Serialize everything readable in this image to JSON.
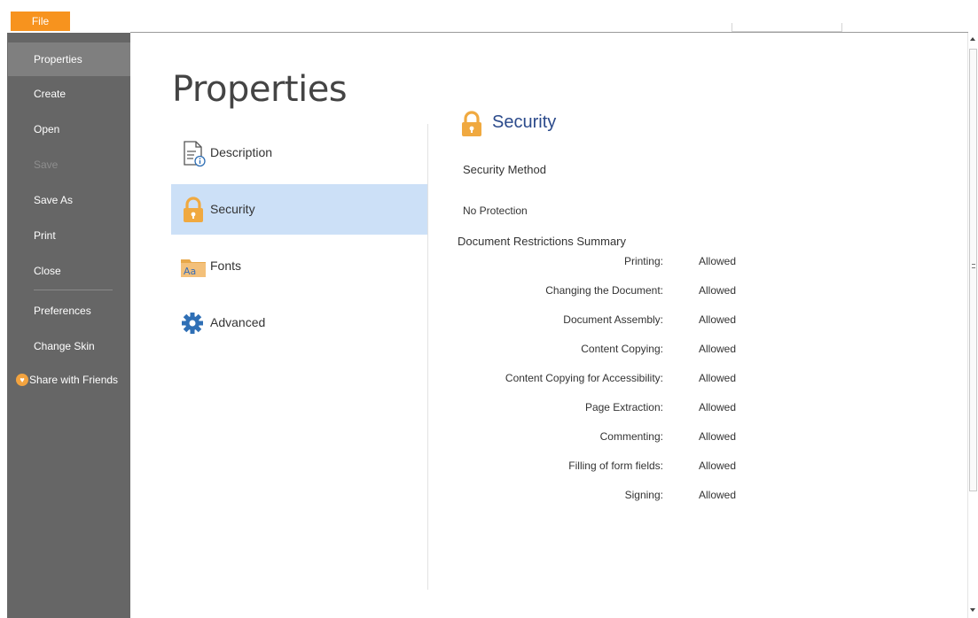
{
  "file_tab": {
    "label": "File"
  },
  "sidebar": {
    "items": [
      {
        "label": "Properties",
        "state": "active"
      },
      {
        "label": "Create",
        "state": "normal"
      },
      {
        "label": "Open",
        "state": "normal"
      },
      {
        "label": "Save",
        "state": "disabled"
      },
      {
        "label": "Save As",
        "state": "normal"
      },
      {
        "label": "Print",
        "state": "normal"
      },
      {
        "label": "Close",
        "state": "normal"
      },
      {
        "label": "Preferences",
        "state": "normal"
      },
      {
        "label": "Change Skin",
        "state": "normal"
      },
      {
        "label": "Share with Friends",
        "state": "normal",
        "icon": "heart-icon"
      }
    ]
  },
  "main": {
    "title": "Properties",
    "categories": [
      {
        "label": "Description",
        "icon": "document-info-icon"
      },
      {
        "label": "Security",
        "icon": "lock-icon",
        "selected": true
      },
      {
        "label": "Fonts",
        "icon": "fonts-icon"
      },
      {
        "label": "Advanced",
        "icon": "gear-icon"
      }
    ]
  },
  "security": {
    "heading": "Security",
    "method_label": "Security Method",
    "method_value": "No Protection",
    "restrictions_title": "Document Restrictions Summary",
    "restrictions": [
      {
        "name": "Printing:",
        "value": "Allowed"
      },
      {
        "name": "Changing the Document:",
        "value": "Allowed"
      },
      {
        "name": "Document Assembly:",
        "value": "Allowed"
      },
      {
        "name": "Content Copying:",
        "value": "Allowed"
      },
      {
        "name": "Content Copying for Accessibility:",
        "value": "Allowed"
      },
      {
        "name": "Page Extraction:",
        "value": "Allowed"
      },
      {
        "name": "Commenting:",
        "value": "Allowed"
      },
      {
        "name": "Filling of form fields:",
        "value": "Allowed"
      },
      {
        "name": "Signing:",
        "value": "Allowed"
      }
    ]
  },
  "colors": {
    "file_tab": "#f7931e",
    "sidebar_bg": "#666666",
    "sidebar_active": "#7f7f7f",
    "selected_category": "#cce0f7",
    "heading_blue": "#2b4a8b",
    "lock_orange": "#f0a940"
  }
}
